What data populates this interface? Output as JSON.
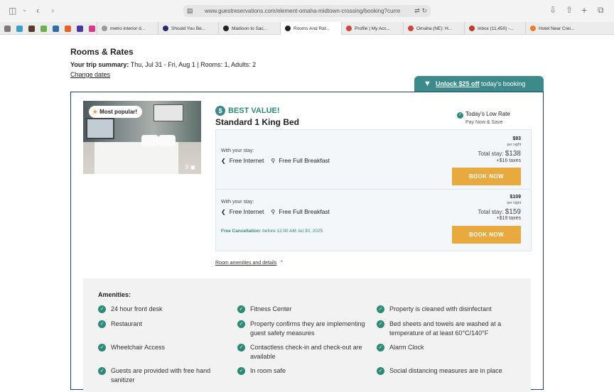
{
  "browser": {
    "url": "www.guestreservations.com/element-omaha-midtown-crossing/booking?curre",
    "tabs": [
      {
        "label": "metro interior d...",
        "color": "#9a9a9a"
      },
      {
        "label": "Should You Be...",
        "color": "#2b2b6b"
      },
      {
        "label": "Madison to Sac...",
        "color": "#222"
      },
      {
        "label": "Rooms And Rat...",
        "color": "#222"
      },
      {
        "label": "Profile | My Acc...",
        "color": "#d2453d"
      },
      {
        "label": "Omaha (NE): H...",
        "color": "#d2453d"
      },
      {
        "label": "Inbox (11,450) -...",
        "color": "#c5392a"
      },
      {
        "label": "Hotel Near Crei...",
        "color": "#e87f2f"
      }
    ],
    "favorites": [
      "#7a7a7a",
      "#3aa0c8",
      "#5a3a2a",
      "#6ab04c",
      "#2d6fa0",
      "#e6622d",
      "#4a3aa0",
      "#d83a8a"
    ]
  },
  "page": {
    "heading": "Rooms & Rates",
    "summary_label": "Your trip summary:",
    "summary_value": "Thu, Jul 31 - Fri, Aug 1 | Rooms: 1, Adults: 2",
    "change_dates": "Change dates",
    "unlock_link": "Unlock $25 off",
    "unlock_rest": " today's booking"
  },
  "room": {
    "popular_badge": "Most popular!",
    "photo_count": "9",
    "best_value": "BEST VALUE!",
    "name": "Standard 1 King Bed",
    "low_rate": "Today's Low Rate",
    "pay_now": "Pay Now & Save",
    "rates": [
      {
        "with_stay": "With your stay:",
        "amenity1": "Free Internet",
        "amenity2": "Free Full Breakfast",
        "price": "$93",
        "per_night": "per night",
        "total_label": "Total stay:",
        "total_value": "$138",
        "taxes": "+$16 taxes",
        "book": "BOOK NOW"
      },
      {
        "with_stay": "With your stay:",
        "amenity1": "Free Internet",
        "amenity2": "Free Full Breakfast",
        "free_cancel": "Free Cancellation:",
        "free_cancel_rest": " before 12:00 AM Jul 30, 2025",
        "price": "$109",
        "per_night": "per night",
        "total_label": "Total stay:",
        "total_value": "$159",
        "taxes": "+$19 taxes",
        "book": "BOOK NOW"
      }
    ],
    "amenities_link": "Room amenities and details"
  },
  "amenities": {
    "title": "Amenities:",
    "items": [
      "24 hour front desk",
      "Fitness Center",
      "Property is cleaned with disinfectant",
      "Restaurant",
      "Property confirms they are implementing guest safety measures",
      "Bed sheets and towels are washed at a temperature of at least 60°C/140°F",
      "Wheelchair Access",
      "Contactless check-in and check-out are available",
      "Alarm Clock",
      "Guests are provided with free hand sanitizer",
      "In room safe",
      "Social distancing measures are in place"
    ]
  }
}
